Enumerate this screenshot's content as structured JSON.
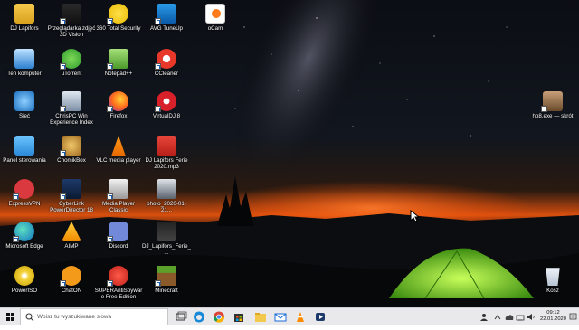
{
  "desktop": {
    "icons": [
      {
        "label": "DJ Lapifors"
      },
      {
        "label": "Przeglądarka zdjęć 3D Vision"
      },
      {
        "label": "360 Total Security"
      },
      {
        "label": "AVG TuneUp"
      },
      {
        "label": "oCam"
      },
      {
        "label": "Ten komputer"
      },
      {
        "label": "µTorrent"
      },
      {
        "label": "Notepad++"
      },
      {
        "label": "CCleaner"
      },
      {
        "label": "Sieć"
      },
      {
        "label": "ChrisPC Win Experience Index"
      },
      {
        "label": "Firefox"
      },
      {
        "label": "VirtualDJ 8"
      },
      {
        "label": "Panel sterowania"
      },
      {
        "label": "ChomikBox"
      },
      {
        "label": "VLC media player"
      },
      {
        "label": "DJ Lapifors Ferie 2020.mp3"
      },
      {
        "label": "ExpressVPN"
      },
      {
        "label": "CyberLink PowerDirector 18"
      },
      {
        "label": "Media Player Classic"
      },
      {
        "label": "photo_2020-01-21..."
      },
      {
        "label": "Microsoft Edge"
      },
      {
        "label": "AIMP"
      },
      {
        "label": "Discord"
      },
      {
        "label": "DJ_Lapifors_Ferie_..."
      },
      {
        "label": "PowerISO"
      },
      {
        "label": "ChatON"
      },
      {
        "label": "SUPERAntiSpyware Free Edition"
      },
      {
        "label": "Minecraft"
      },
      {
        "label": "hp8.exe — skrót"
      },
      {
        "label": "Kosz"
      }
    ]
  },
  "taskbar": {
    "search_placeholder": "Wpisz tu wyszukiwane słowa",
    "apps": [
      "task-view",
      "edge",
      "chrome",
      "store",
      "explorer",
      "mail",
      "vlc",
      "powerdirector"
    ],
    "time": "09:12",
    "date": "22.01.2020"
  },
  "colors": {
    "taskbar_bg": "#e9e9ec",
    "tent": "#7ed321",
    "sunset": "#ff6a1a"
  }
}
